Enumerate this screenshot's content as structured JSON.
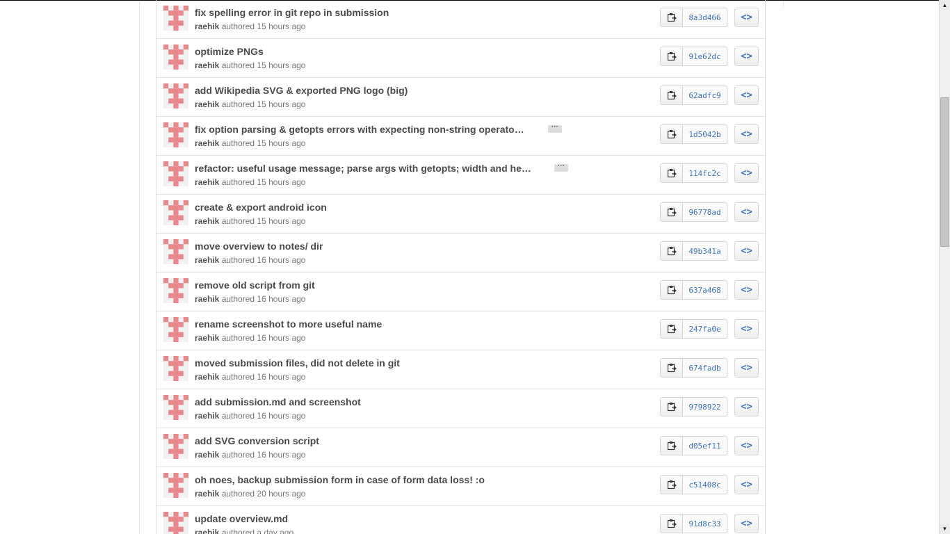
{
  "commits": [
    {
      "title": "fix spelling error in git repo in submission",
      "author": "raehik",
      "verb": "authored",
      "time": "15 hours ago",
      "sha": "8a3d466",
      "truncated": false
    },
    {
      "title": "optimize PNGs",
      "author": "raehik",
      "verb": "authored",
      "time": "15 hours ago",
      "sha": "91e62dc",
      "truncated": false
    },
    {
      "title": "add Wikipedia SVG & exported PNG logo (big)",
      "author": "raehik",
      "verb": "authored",
      "time": "15 hours ago",
      "sha": "62adfc9",
      "truncated": false
    },
    {
      "title": "fix option parsing & getopts errors with expecting non-string operato…",
      "author": "raehik",
      "verb": "authored",
      "time": "15 hours ago",
      "sha": "1d5042b",
      "truncated": true
    },
    {
      "title": "refactor: useful usage message; parse args with getopts; width and he…",
      "author": "raehik",
      "verb": "authored",
      "time": "15 hours ago",
      "sha": "114fc2c",
      "truncated": true
    },
    {
      "title": "create & export android icon",
      "author": "raehik",
      "verb": "authored",
      "time": "15 hours ago",
      "sha": "96778ad",
      "truncated": false
    },
    {
      "title": "move overview to notes/ dir",
      "author": "raehik",
      "verb": "authored",
      "time": "16 hours ago",
      "sha": "49b341a",
      "truncated": false
    },
    {
      "title": "remove old script from git",
      "author": "raehik",
      "verb": "authored",
      "time": "16 hours ago",
      "sha": "637a468",
      "truncated": false
    },
    {
      "title": "rename screenshot to more useful name",
      "author": "raehik",
      "verb": "authored",
      "time": "16 hours ago",
      "sha": "247fa0e",
      "truncated": false
    },
    {
      "title": "moved submission files, did not delete in git",
      "author": "raehik",
      "verb": "authored",
      "time": "16 hours ago",
      "sha": "674fadb",
      "truncated": false
    },
    {
      "title": "add submission.md and screenshot",
      "author": "raehik",
      "verb": "authored",
      "time": "16 hours ago",
      "sha": "9798922",
      "truncated": false
    },
    {
      "title": "add SVG conversion script",
      "author": "raehik",
      "verb": "authored",
      "time": "16 hours ago",
      "sha": "d05ef11",
      "truncated": false
    },
    {
      "title": "oh noes, backup submission form in case of form data loss! :o",
      "author": "raehik",
      "verb": "authored",
      "time": "20 hours ago",
      "sha": "c51408c",
      "truncated": false
    },
    {
      "title": "update overview.md",
      "author": "raehik",
      "verb": "authored",
      "time": "a day ago",
      "sha": "91d8c33",
      "truncated": false
    }
  ],
  "icons": {
    "avatar": "identicon-avatar",
    "copy": "clippy-icon",
    "browse": "code-icon",
    "expand": "ellipsis-icon"
  },
  "colors": {
    "identicon": "#e8888a",
    "sha_link": "#4078c0",
    "title_text": "#4a4a4a"
  }
}
